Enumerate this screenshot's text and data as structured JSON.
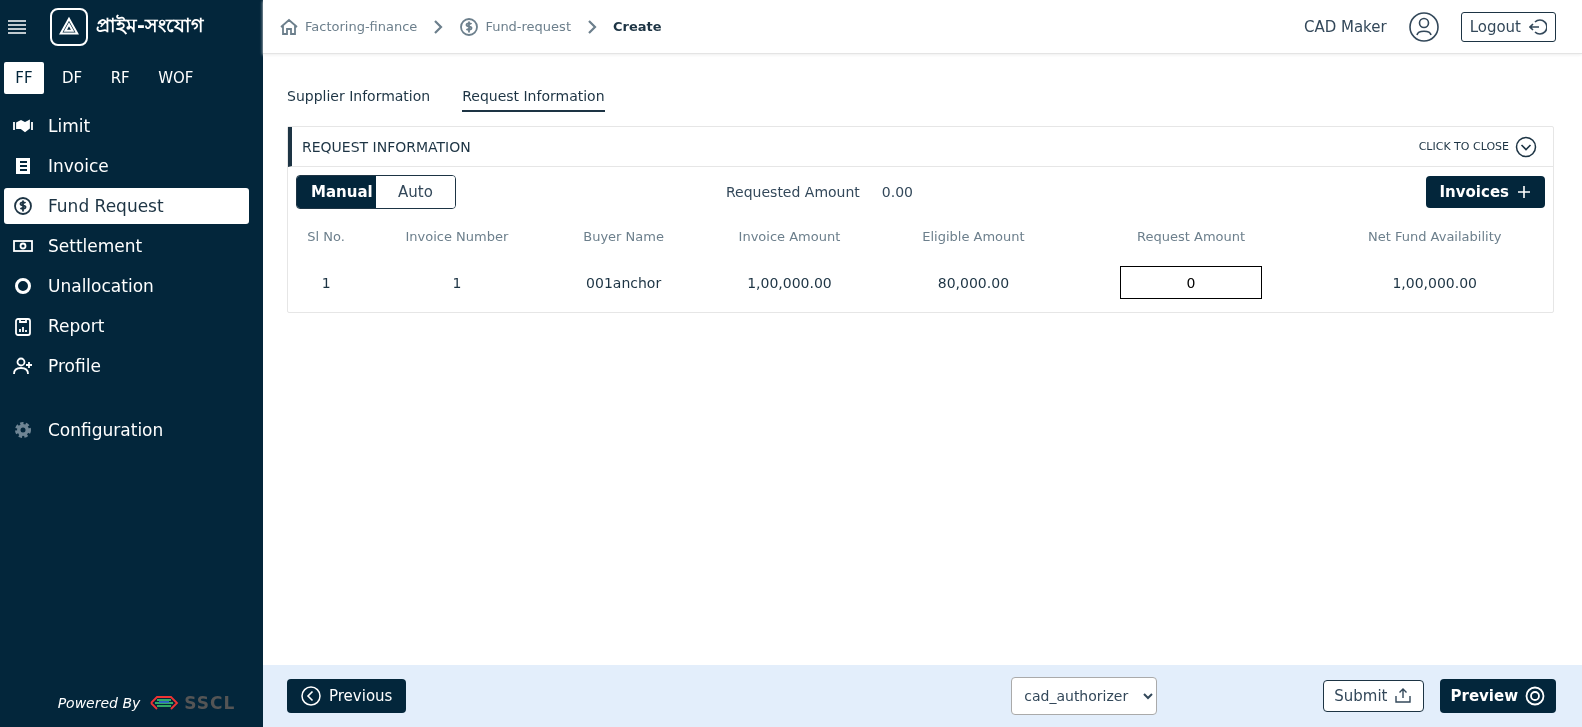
{
  "sidebar": {
    "brand": "প্রাইম-সংযোগ",
    "program_tabs": [
      {
        "label": "FF",
        "selected": true
      },
      {
        "label": "DF",
        "selected": false
      },
      {
        "label": "RF",
        "selected": false
      },
      {
        "label": "WOF",
        "selected": false
      }
    ],
    "items": [
      {
        "label": "Limit",
        "selected": false
      },
      {
        "label": "Invoice",
        "selected": false
      },
      {
        "label": "Fund Request",
        "selected": true
      },
      {
        "label": "Settlement",
        "selected": false
      },
      {
        "label": "Unallocation",
        "selected": false
      },
      {
        "label": "Report",
        "selected": false
      },
      {
        "label": "Profile",
        "selected": false
      }
    ],
    "config_item": {
      "label": "Configuration",
      "selected": false
    },
    "powered_by": "Powered By",
    "vendor": "SSCL"
  },
  "breadcrumb": [
    {
      "label": "Factoring-finance",
      "current": false
    },
    {
      "label": "Fund-request",
      "current": false
    },
    {
      "label": "Create",
      "current": true
    }
  ],
  "user": {
    "name": "CAD Maker",
    "logout": "Logout"
  },
  "tabs": [
    {
      "label": "Supplier Information",
      "selected": false
    },
    {
      "label": "Request Information",
      "selected": true
    }
  ],
  "section": {
    "title": "REQUEST INFORMATION",
    "toggle": "CLICK TO CLOSE",
    "mode_toggle": [
      {
        "label": "Manual",
        "selected": true
      },
      {
        "label": "Auto",
        "selected": false
      }
    ],
    "requested_amount_label": "Requested Amount",
    "requested_amount": "0.00",
    "invoices_button": "Invoices",
    "table": {
      "columns": [
        "Sl No.",
        "Invoice Number",
        "Buyer Name",
        "Invoice Amount",
        "Eligible Amount",
        "Request Amount",
        "Net Fund Availability"
      ],
      "rows": [
        {
          "sl": "1",
          "invoice_number": "1",
          "buyer": "001anchor",
          "invoice_amount": "1,00,000.00",
          "eligible_amount": "80,000.00",
          "request_amount": "0",
          "net_fund": "1,00,000.00"
        }
      ]
    }
  },
  "footer": {
    "previous": "Previous",
    "approver": "cad_authorizer",
    "submit": "Submit",
    "preview": "Preview"
  }
}
